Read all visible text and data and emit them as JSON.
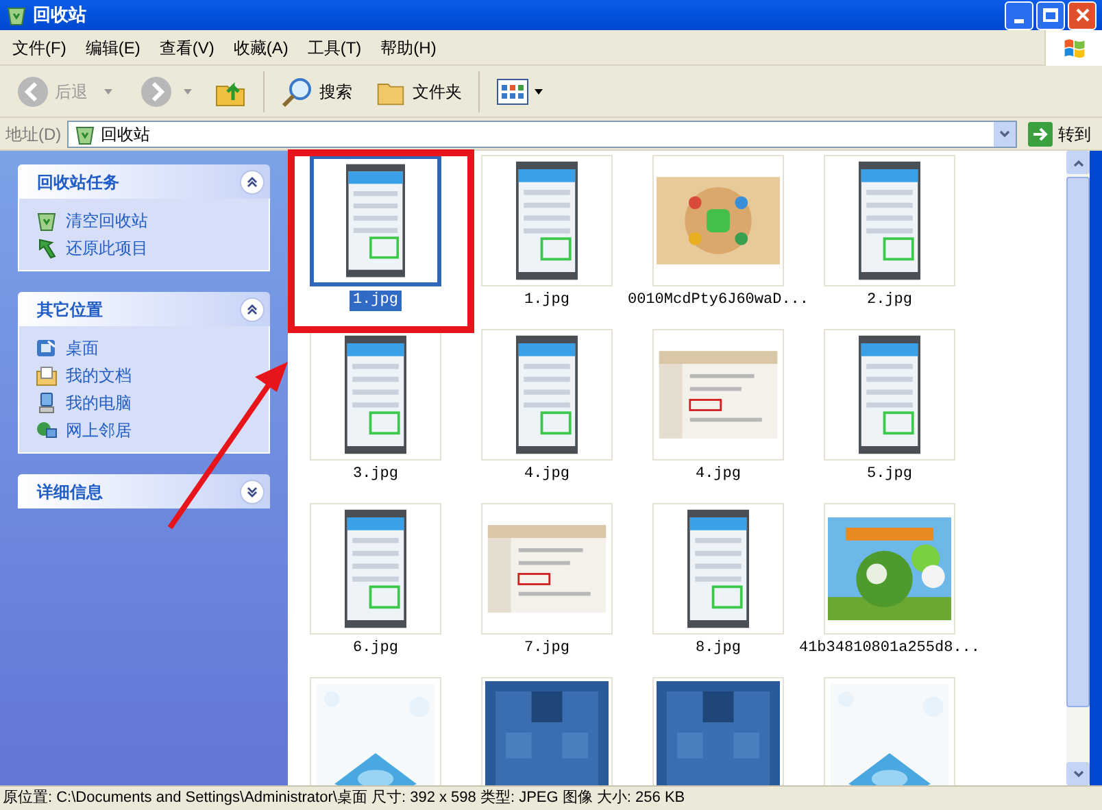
{
  "window": {
    "title": "回收站"
  },
  "menu": [
    {
      "label": "文件(F)"
    },
    {
      "label": "编辑(E)"
    },
    {
      "label": "查看(V)"
    },
    {
      "label": "收藏(A)"
    },
    {
      "label": "工具(T)"
    },
    {
      "label": "帮助(H)"
    }
  ],
  "toolbar": {
    "back": {
      "label": "后退",
      "disabled": true
    },
    "forward": {
      "disabled": true
    },
    "search": {
      "label": "搜索"
    },
    "folders": {
      "label": "文件夹"
    }
  },
  "address": {
    "label": "地址(D)",
    "value": "回收站",
    "go": "转到"
  },
  "sidebar": [
    {
      "title": "回收站任务",
      "expanded": true,
      "items": [
        {
          "label": "清空回收站",
          "kind": "bin"
        },
        {
          "label": "还原此项目",
          "kind": "restore"
        }
      ]
    },
    {
      "title": "其它位置",
      "expanded": true,
      "items": [
        {
          "label": "桌面",
          "kind": "desktop"
        },
        {
          "label": "我的文档",
          "kind": "documents"
        },
        {
          "label": "我的电脑",
          "kind": "computer"
        },
        {
          "label": "网上邻居",
          "kind": "network"
        }
      ]
    },
    {
      "title": "详细信息",
      "expanded": false
    }
  ],
  "files": [
    {
      "name": "1.jpg",
      "selected": true,
      "kind": "phone"
    },
    {
      "name": "1.jpg",
      "selected": false,
      "kind": "phone"
    },
    {
      "name": "0010McdPty6J60waD...",
      "selected": false,
      "kind": "poster"
    },
    {
      "name": "2.jpg",
      "selected": false,
      "kind": "phone"
    },
    {
      "name": "3.jpg",
      "selected": false,
      "kind": "phone"
    },
    {
      "name": "4.jpg",
      "selected": false,
      "kind": "phone"
    },
    {
      "name": "4.jpg",
      "selected": false,
      "kind": "document"
    },
    {
      "name": "5.jpg",
      "selected": false,
      "kind": "phone"
    },
    {
      "name": "6.jpg",
      "selected": false,
      "kind": "phone"
    },
    {
      "name": "7.jpg",
      "selected": false,
      "kind": "document"
    },
    {
      "name": "8.jpg",
      "selected": false,
      "kind": "phone"
    },
    {
      "name": "41b34810801a255d8...",
      "selected": false,
      "kind": "globe"
    },
    {
      "selected": false,
      "kind": "fish"
    },
    {
      "selected": false,
      "kind": "game"
    },
    {
      "selected": false,
      "kind": "game"
    },
    {
      "selected": false,
      "kind": "fish"
    }
  ],
  "status_bar": "原位置: C:\\Documents and Settings\\Administrator\\桌面 尺寸: 392 x 598 类型: JPEG 图像 大小: 256 KB"
}
